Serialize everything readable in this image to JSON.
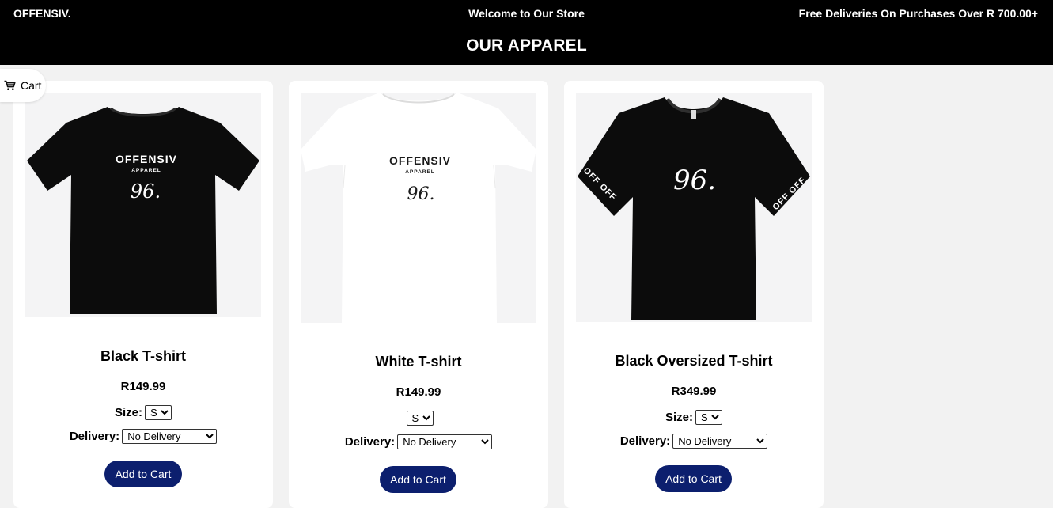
{
  "header": {
    "brand": "OFFENSIV.",
    "welcome": "Welcome to Our Store",
    "promo": "Free Deliveries On Purchases Over R 700.00+",
    "title": "OUR APPAREL"
  },
  "cart": {
    "label": "Cart",
    "icon": "shopping-cart-icon"
  },
  "products": [
    {
      "name": "Black T-shirt",
      "price": "R149.99",
      "size_label": "Size:",
      "size_value": "S",
      "delivery_label": "Delivery:",
      "delivery_value": "No Delivery",
      "button": "Add to Cart",
      "shirt": {
        "color": "#0c0c0c",
        "print_color": "#ffffff",
        "print_title": "OFFENSIV",
        "print_sub": "APPAREL",
        "print_number": "96."
      }
    },
    {
      "name": "White T-shirt",
      "price": "R149.99",
      "size_label": "",
      "size_value": "S",
      "delivery_label": "Delivery:",
      "delivery_value": "No Delivery",
      "button": "Add to Cart",
      "shirt": {
        "color": "#ffffff",
        "print_color": "#1a1a1a",
        "print_title": "OFFENSIV",
        "print_sub": "APPAREL",
        "print_number": "96."
      }
    },
    {
      "name": "Black Oversized T-shirt",
      "price": "R349.99",
      "size_label": "Size:",
      "size_value": "S",
      "delivery_label": "Delivery:",
      "delivery_value": "No Delivery",
      "button": "Add to Cart",
      "shirt": {
        "color": "#0c0c0c",
        "print_color": "#ffffff",
        "print_number": "96.",
        "sleeve_text": "OFF OFF"
      }
    }
  ]
}
